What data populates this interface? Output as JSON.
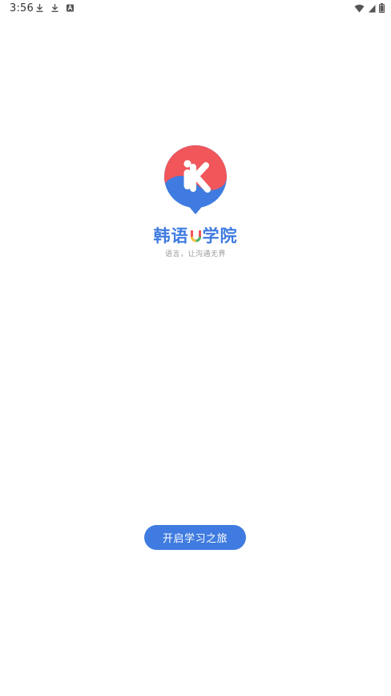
{
  "status_bar": {
    "time": "3:56",
    "left_icons": [
      "download-icon",
      "download-icon",
      "app-notification-icon"
    ],
    "right_icons": [
      "wifi-icon",
      "signal-icon",
      "battery-icon"
    ]
  },
  "brand": {
    "name_part1": "韩语",
    "name_u": "U",
    "name_part2": "学院",
    "slogan": "语言，让沟通无界",
    "logo_icon": "ik-logo-icon",
    "colors": {
      "logo_red": "#f0565a",
      "logo_blue": "#3f7be0",
      "title_blue": "#3f7be0"
    }
  },
  "start_button": {
    "label": "开启学习之旅",
    "color": "#3f7be0"
  }
}
